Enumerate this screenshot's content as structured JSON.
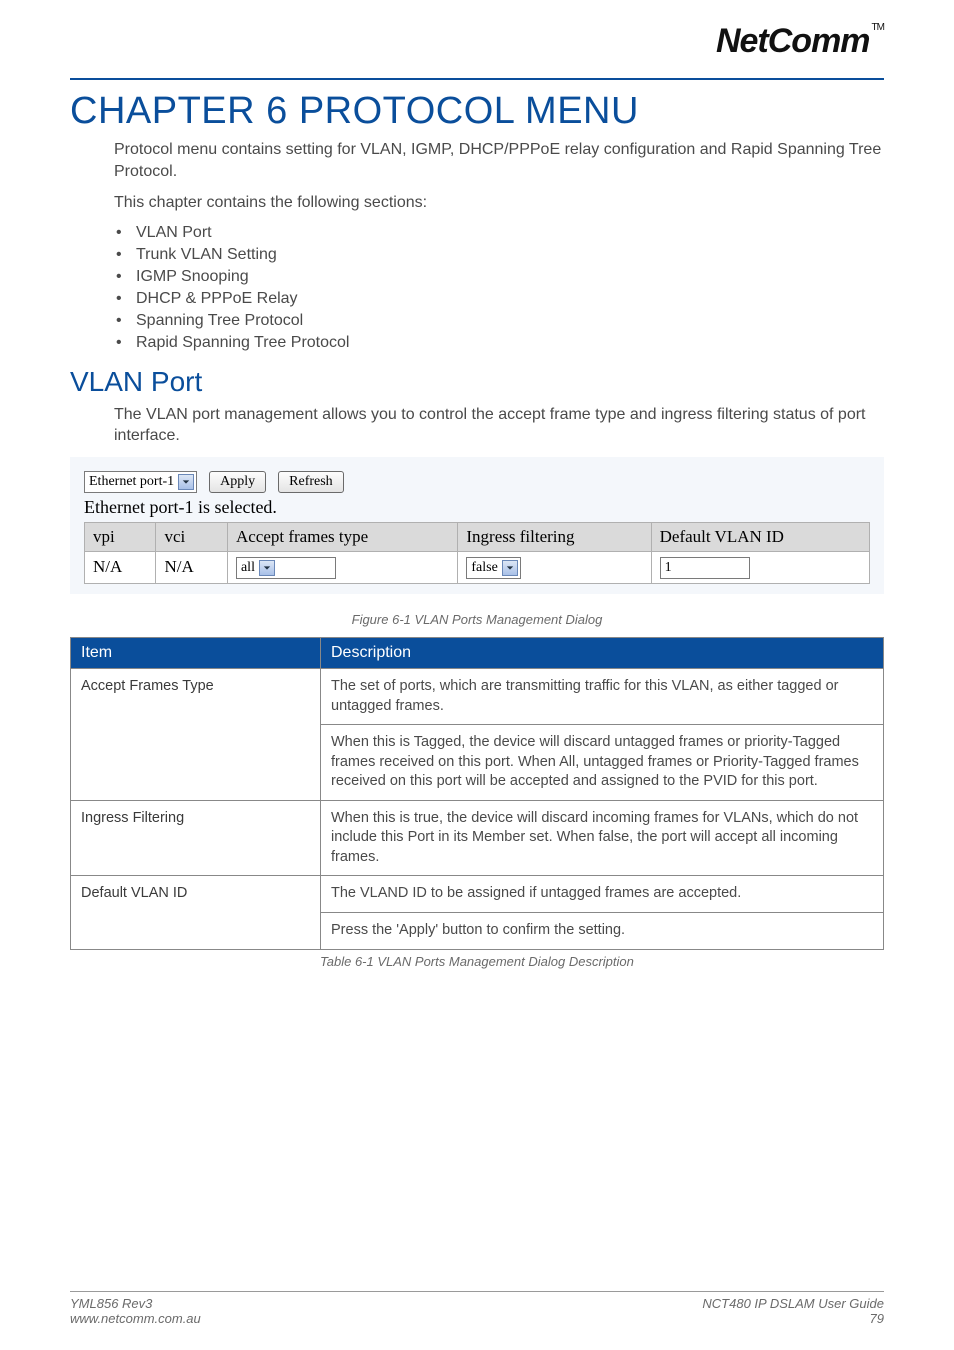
{
  "logo": {
    "text": "NetComm",
    "tm": "TM"
  },
  "chapter": {
    "title": "CHAPTER 6    PROTOCOL MENU"
  },
  "intro": {
    "p1": "Protocol menu contains setting for VLAN, IGMP, DHCP/PPPoE relay configuration and Rapid Spanning Tree Protocol.",
    "p2": "This chapter contains the following sections:",
    "items": [
      "VLAN Port",
      "Trunk VLAN Setting",
      "IGMP Snooping",
      "DHCP & PPPoE Relay",
      "Spanning Tree Protocol",
      "Rapid Spanning Tree Protocol"
    ]
  },
  "section": {
    "title": "VLAN Port",
    "p": "The VLAN port management allows you to control the accept frame type and ingress filtering status of port interface."
  },
  "figure": {
    "port_select": "Ethernet port-1",
    "apply": "Apply",
    "refresh": "Refresh",
    "status": "Ethernet port-1 is selected.",
    "headers": {
      "vpi": "vpi",
      "vci": "vci",
      "aft": "Accept frames type",
      "ing": "Ingress filtering",
      "dvid": "Default VLAN ID"
    },
    "row": {
      "vpi": "N/A",
      "vci": "N/A",
      "aft": "all",
      "ing": "false",
      "dvid": "1"
    },
    "caption": "Figure 6-1 VLAN Ports Management Dialog"
  },
  "table": {
    "headers": {
      "item": "Item",
      "desc": "Description"
    },
    "rows": {
      "aft": {
        "label": "Accept Frames Type",
        "d1": "The set of ports, which are transmitting traffic for this VLAN, as either tagged or untagged frames.",
        "d2": "When this is Tagged, the device will discard untagged frames or priority-Tagged frames received on this port. When All, untagged frames or Priority-Tagged frames received on this port will be accepted and assigned to the PVID for this port."
      },
      "ing": {
        "label": "Ingress Filtering",
        "d1": "When this is true, the device will discard incoming frames for VLANs, which do not include this Port in its Member set. When false, the port will accept all incoming frames."
      },
      "dvid": {
        "label": "Default VLAN ID",
        "d1": "The VLAND ID to be assigned if untagged frames are accepted.",
        "d2": "Press the 'Apply' button to confirm the setting."
      }
    },
    "caption": "Table 6-1 VLAN Ports Management Dialog Description"
  },
  "footer": {
    "left1": "YML856 Rev3",
    "left2": "www.netcomm.com.au",
    "right1": "NCT480 IP DSLAM User Guide",
    "right2": "79"
  }
}
